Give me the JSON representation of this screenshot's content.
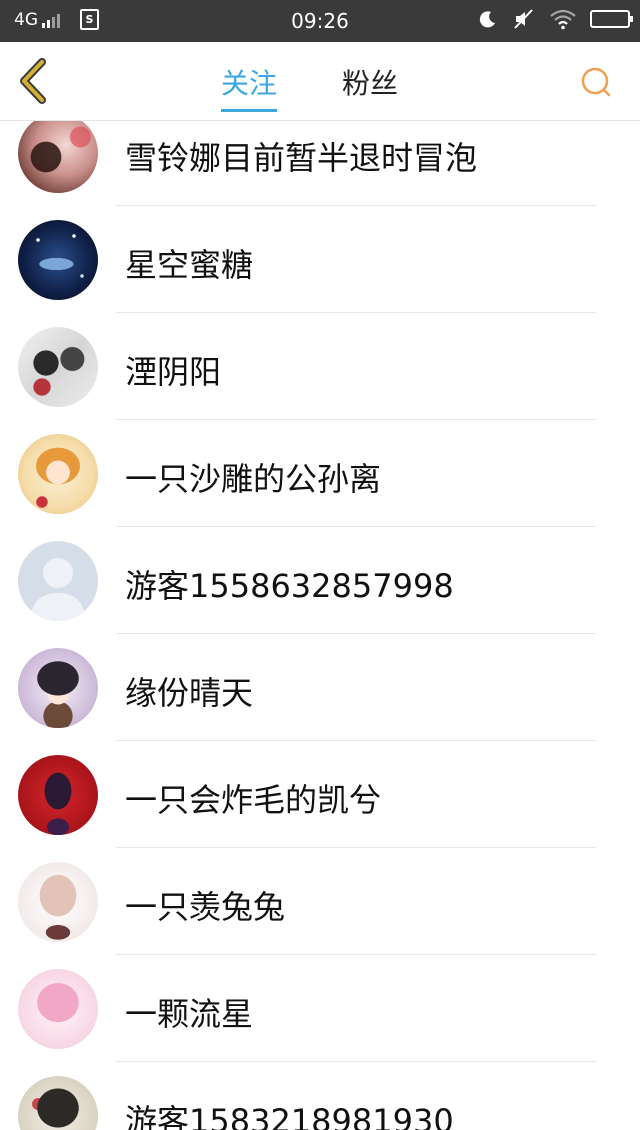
{
  "status_bar": {
    "network": "4G",
    "time": "09:26",
    "icons": [
      "signal-icon",
      "sim-icon",
      "moon-icon",
      "mute-icon",
      "wifi-icon",
      "battery-icon"
    ]
  },
  "header": {
    "tabs": [
      {
        "label": "关注",
        "active": true
      },
      {
        "label": "粉丝",
        "active": false
      }
    ],
    "accent_color": "#3ea7e0",
    "back_icon_color": "#d4b035",
    "search_icon_color": "#f0a050"
  },
  "users": [
    {
      "name": "雪铃娜目前暂半退时冒泡",
      "avatar": "anime-girl-flowers"
    },
    {
      "name": "星空蜜糖",
      "avatar": "galaxy-whale"
    },
    {
      "name": "湮阴阳",
      "avatar": "anime-duo"
    },
    {
      "name": "一只沙雕的公孙离",
      "avatar": "anime-fox-girl"
    },
    {
      "name": "游客1558632857998",
      "avatar": "default-silhouette"
    },
    {
      "name": "缘份晴天",
      "avatar": "anime-cat-boy"
    },
    {
      "name": "一只会炸毛的凯兮",
      "avatar": "anime-red-cat"
    },
    {
      "name": "一只羡兔兔",
      "avatar": "anime-pink-hair"
    },
    {
      "name": "一颗流星",
      "avatar": "anime-pink-girl"
    },
    {
      "name": "游客1583218981930",
      "avatar": "anime-flower-girl"
    }
  ]
}
